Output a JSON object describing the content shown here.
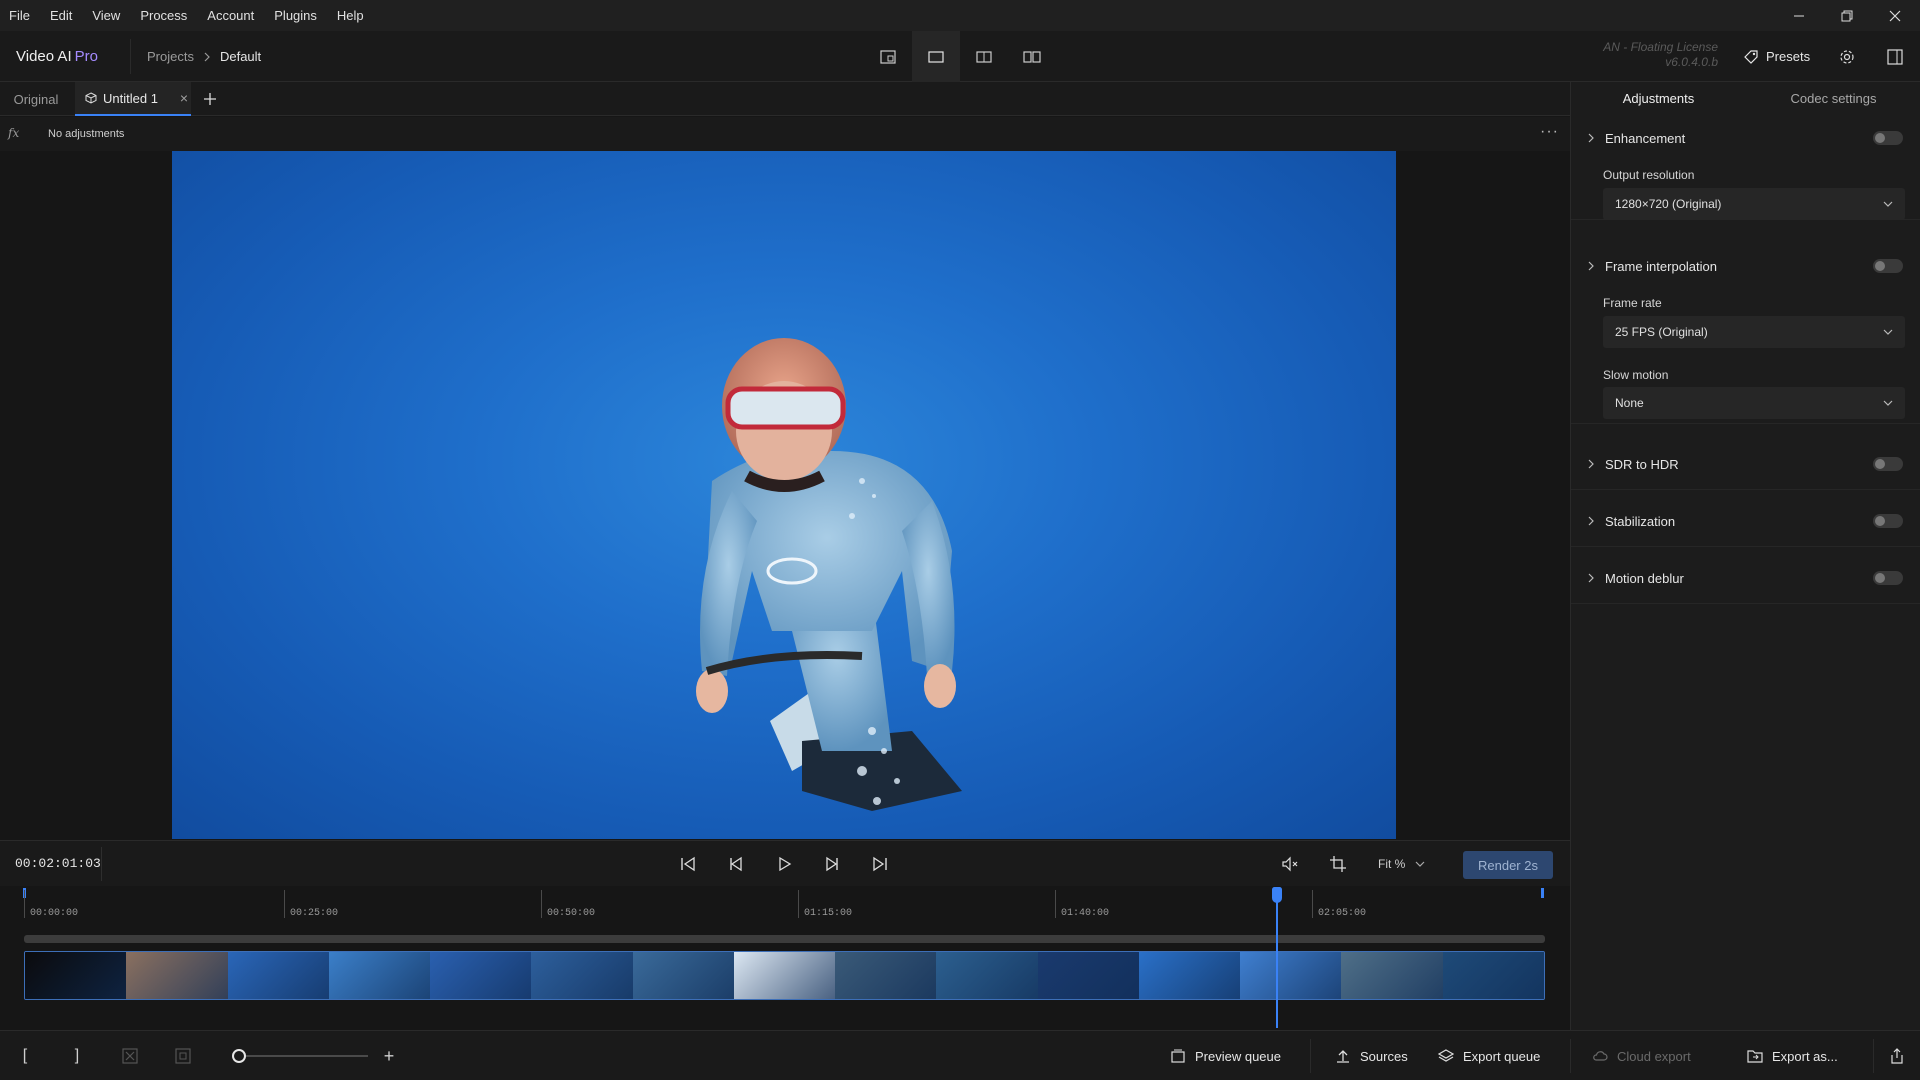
{
  "menu": [
    "File",
    "Edit",
    "View",
    "Process",
    "Account",
    "Plugins",
    "Help"
  ],
  "header": {
    "app_name": "Video AI",
    "app_tier": "Pro",
    "breadcrumb": [
      "Projects",
      "Default"
    ],
    "license_line1": "AN - Floating License",
    "license_line2": "v6.0.4.0.b",
    "presets_label": "Presets"
  },
  "tabs": {
    "original": "Original",
    "active": "Untitled 1",
    "close": "×"
  },
  "adjustments_strip": {
    "fx": "fx",
    "status": "No adjustments",
    "more": "···"
  },
  "transport": {
    "timecode": "00:02:01:03",
    "fit_label": "Fit %",
    "render_label": "Render 2s"
  },
  "timeline": {
    "ticks": [
      "00:00:00",
      "00:25:00",
      "00:50:00",
      "01:15:00",
      "01:40:00",
      "02:05:00"
    ],
    "playhead_fraction": 0.823,
    "frame_colors": [
      "#0b0b0d",
      "#8a7060",
      "#2a66b8",
      "#3b7fc9",
      "#2a60b0",
      "#2d5f9c",
      "#3a6a9a",
      "#dce7f2",
      "#3a5a78",
      "#2c5f8f",
      "#1a3a6e",
      "#2a70c8",
      "#3f7fd0",
      "#4f6f88",
      "#1e4a78"
    ]
  },
  "bottom_bar": {
    "in_mark": "[",
    "out_mark": "]",
    "zoom_plus": "+",
    "preview_queue": "Preview queue",
    "sources": "Sources",
    "export_queue": "Export queue",
    "cloud_export": "Cloud export",
    "export_as": "Export as..."
  },
  "right_panel": {
    "tab_adjustments": "Adjustments",
    "tab_codec": "Codec settings",
    "enhancement": "Enhancement",
    "output_resolution_label": "Output resolution",
    "output_resolution_value": "1280×720 (Original)",
    "frame_interpolation": "Frame interpolation",
    "frame_rate_label": "Frame rate",
    "frame_rate_value": "25 FPS (Original)",
    "slow_motion_label": "Slow motion",
    "slow_motion_value": "None",
    "sdr_to_hdr": "SDR to HDR",
    "stabilization": "Stabilization",
    "motion_deblur": "Motion deblur"
  },
  "colors": {
    "accent": "#3a82f7",
    "pro": "#a58bff",
    "render_button": "#2d4770",
    "water": "#1f6fcb"
  }
}
